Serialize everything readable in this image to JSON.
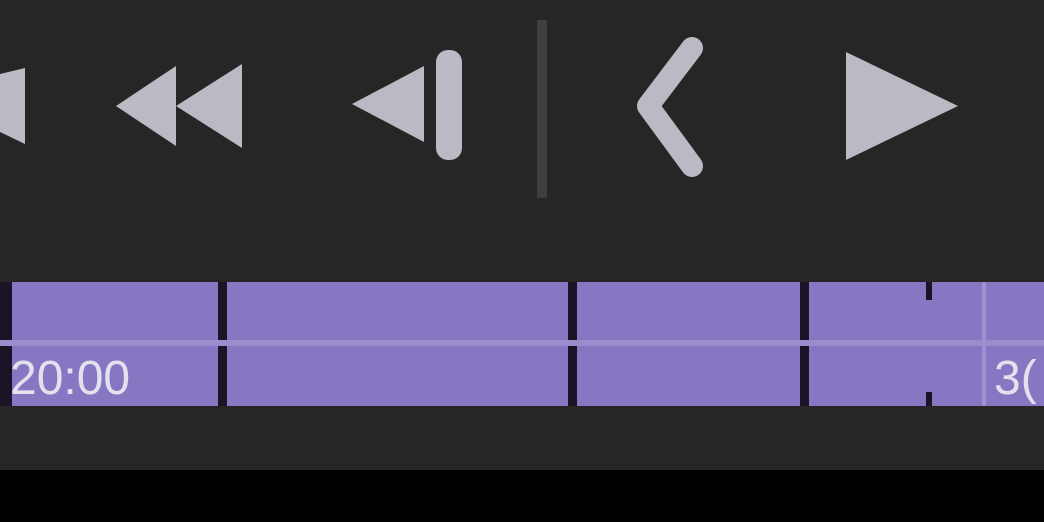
{
  "controls": {
    "skip_to_start_icon": "skip-to-start-icon",
    "rewind_icon": "rewind-icon",
    "step_back_icon": "step-back-icon",
    "previous_icon": "chevron-left-icon",
    "play_icon": "play-icon"
  },
  "colors": {
    "background": "#262626",
    "icon": "#babac4",
    "timeline": "#8777c2",
    "tick": "#1a1426"
  },
  "timeline": {
    "label_left": "20:00",
    "label_right": "3("
  }
}
